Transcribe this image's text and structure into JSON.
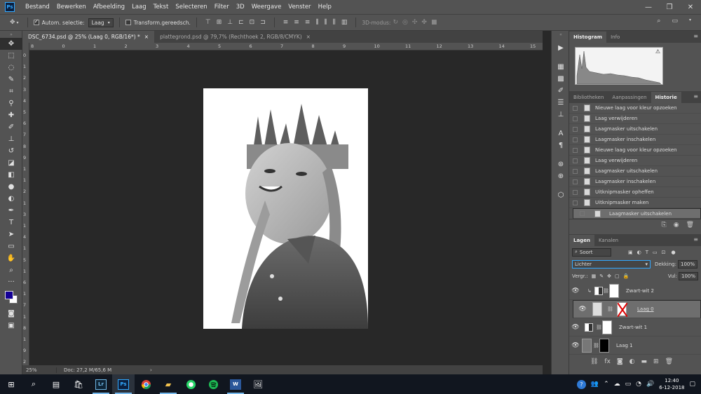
{
  "app": {
    "logo": "Ps"
  },
  "menu": [
    "Bestand",
    "Bewerken",
    "Afbeelding",
    "Laag",
    "Tekst",
    "Selecteren",
    "Filter",
    "3D",
    "Weergave",
    "Venster",
    "Help"
  ],
  "window_controls": [
    "—",
    "❐",
    "✕"
  ],
  "options": {
    "auto_select_label": "Autom. selectie:",
    "auto_select_value": "Laag",
    "transform_label": "Transform.gereedsch.",
    "mode_label": "3D-modus:"
  },
  "doc_tabs": [
    {
      "title": "DSC_6734.psd @ 25% (Laag 0, RGB/16*) *",
      "close": "×"
    },
    {
      "title": "plattegrond.psd @ 79,7% (Rechthoek 2, RGB/8/CMYK)",
      "close": "×"
    }
  ],
  "ruler_top": [
    "8",
    "0",
    "1",
    "2",
    "3",
    "4",
    "5",
    "6",
    "7",
    "8",
    "9",
    "10",
    "11",
    "12",
    "13",
    "14",
    "15"
  ],
  "ruler_left": [
    "0",
    "1",
    "2",
    "3",
    "4",
    "5",
    "6",
    "7",
    "8",
    "9",
    "1",
    "1",
    "2",
    "1",
    "3",
    "1",
    "4",
    "1",
    "5",
    "1",
    "6",
    "1",
    "7",
    "1",
    "8",
    "1",
    "9",
    "2"
  ],
  "status": {
    "zoom": "25%",
    "doc": "Doc: 27,2 M/65,6 M",
    "arrow": "›"
  },
  "histogram_panel": {
    "tabs": [
      "Histogram",
      "Info"
    ],
    "warning": "⚠"
  },
  "history_panel": {
    "tabs": [
      "Bibliotheken",
      "Aanpassingen",
      "Historie"
    ],
    "items": [
      "Nieuwe laag voor kleur opzoeken",
      "Laag verwijderen",
      "Laagmasker uitschakelen",
      "Laagmasker inschakelen",
      "Nieuwe laag voor kleur opzoeken",
      "Laag verwijderen",
      "Laagmasker uitschakelen",
      "Laagmasker inschakelen",
      "Uitknipmasker opheffen",
      "Uitknipmasker maken",
      "Laagmasker uitschakelen"
    ],
    "selected_index": 10
  },
  "layers_panel": {
    "tabs": [
      "Lagen",
      "Kanalen"
    ],
    "filter": "Soort",
    "blend_mode": "Lichter",
    "opacity_label": "Dekking:",
    "opacity_value": "100%",
    "lock_label": "Vergr.:",
    "fill_label": "Vul:",
    "fill_value": "100%",
    "layers": [
      {
        "name": "Zwart-wit 2",
        "kind": "adjustment",
        "clipped": true
      },
      {
        "name": "Laag 0",
        "kind": "image",
        "selected": true
      },
      {
        "name": "Zwart-wit 1",
        "kind": "adjustment"
      },
      {
        "name": "Laag 1",
        "kind": "photo"
      }
    ]
  },
  "taskbar": {
    "apps": [
      "Lr",
      "Ps"
    ],
    "time": "12:40",
    "date": "6-12-2018"
  },
  "colors": {
    "foreground": "#140096",
    "background": "#ffffff",
    "accent": "#31a8ff"
  }
}
